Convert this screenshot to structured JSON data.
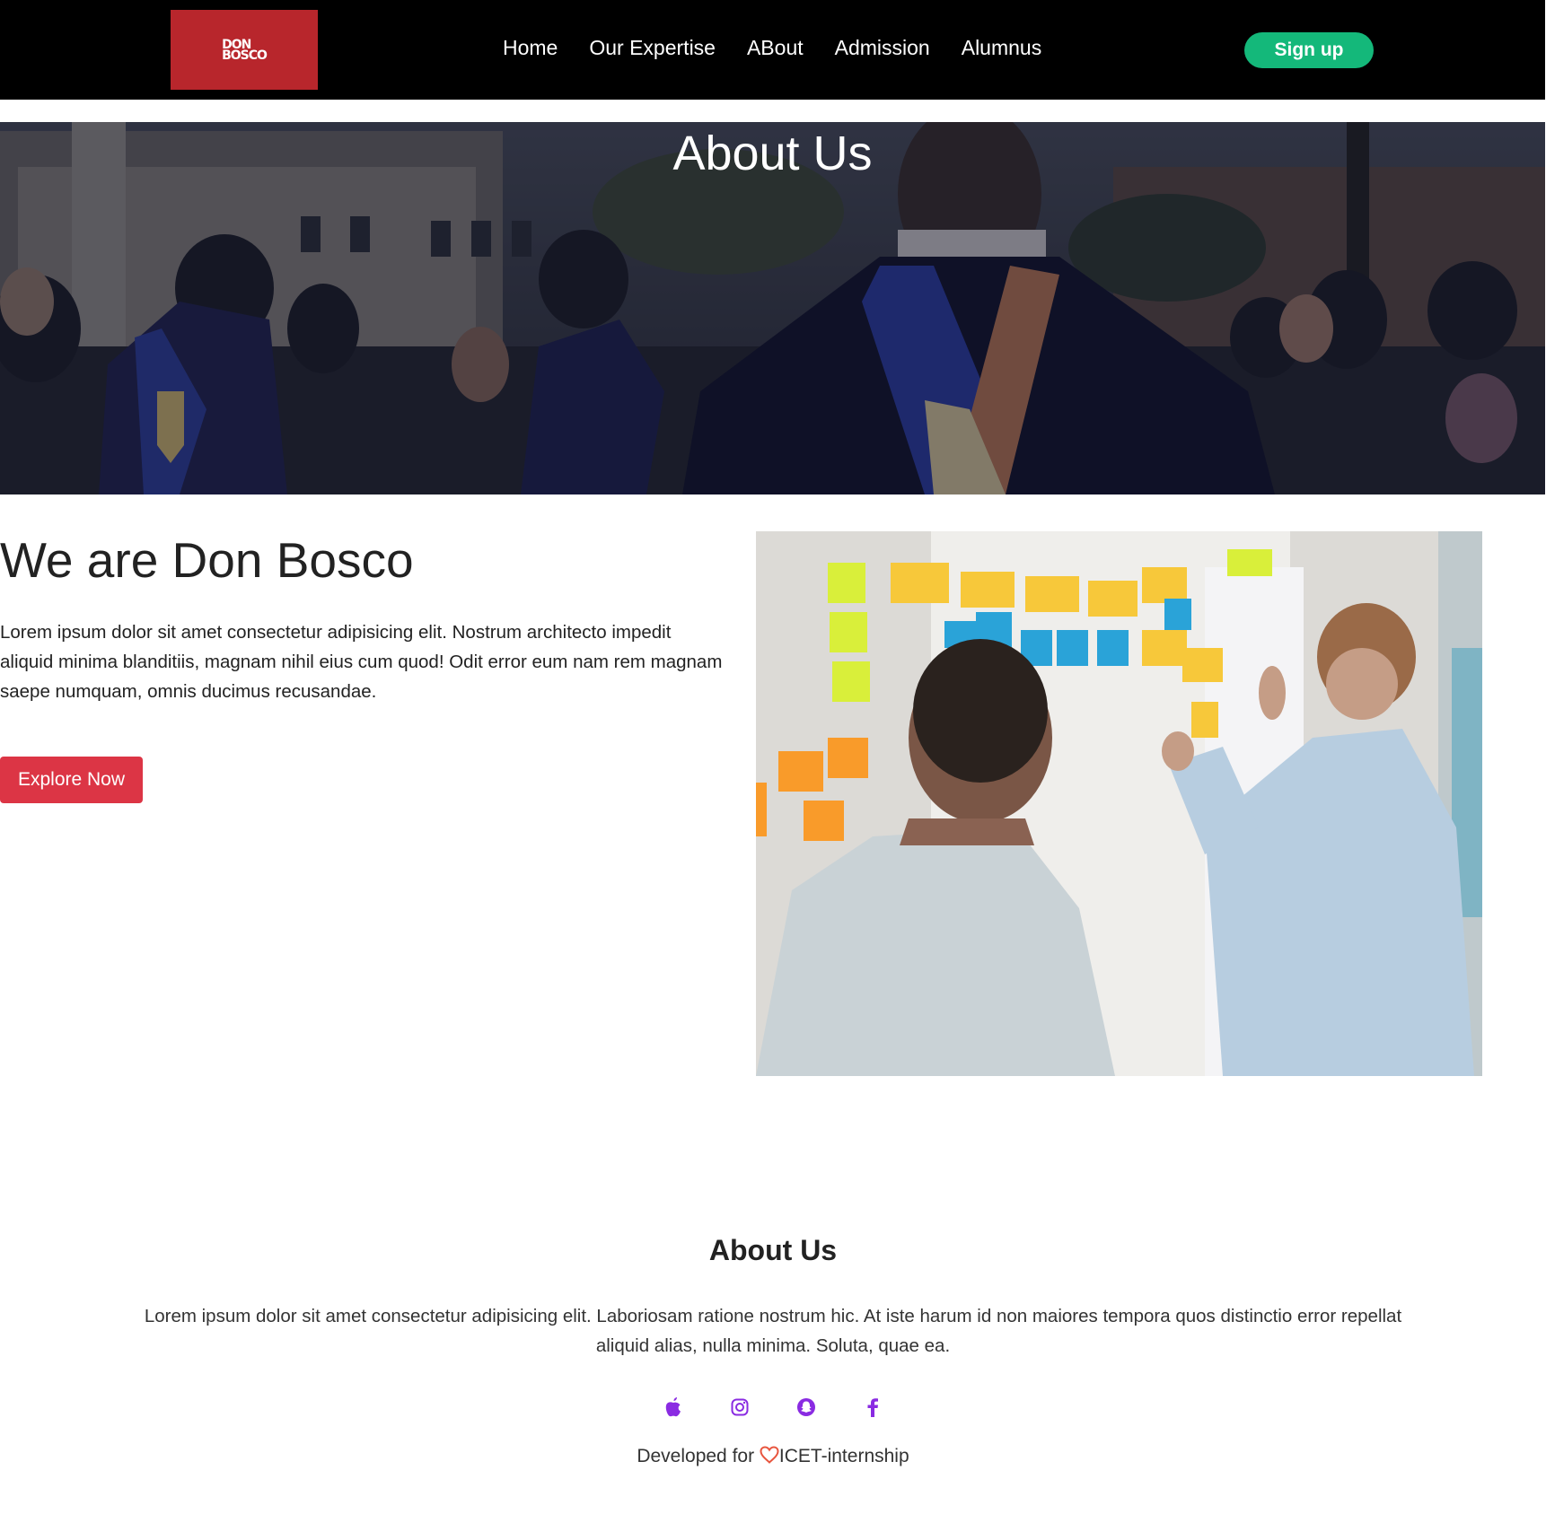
{
  "brand": {
    "logo_text_line1": "DON",
    "logo_text_line2": "BOSCO",
    "logo_color": "#b8262c"
  },
  "nav": {
    "items": [
      {
        "label": "Home"
      },
      {
        "label": "Our Expertise"
      },
      {
        "label": "ABout"
      },
      {
        "label": "Admission"
      },
      {
        "label": "Alumnus"
      }
    ],
    "signup_label": "Sign up",
    "signup_color": "#14b87a"
  },
  "hero": {
    "title": "About Us",
    "image": "graduation-crowd-photo"
  },
  "intro": {
    "heading": "We are Don Bosco",
    "paragraph": "Lorem ipsum dolor sit amet consectetur adipisicing elit. Nostrum architecto impedit aliquid minima blanditiis, magnam nihil eius cum quod! Odit error eum nam rem magnam saepe numquam, omnis ducimus recusandae.",
    "button_label": "Explore Now",
    "button_color": "#dc3545",
    "image": "sticky-notes-whiteboard-photo"
  },
  "footer": {
    "title": "About Us",
    "text": "Lorem ipsum dolor sit amet consectetur adipisicing elit. Laboriosam ratione nostrum hic. At iste harum id non maiores tempora quos distinctio error repellat aliquid alias, nulla minima. Soluta, quae ea.",
    "socials": [
      "apple-icon",
      "instagram-icon",
      "snapchat-icon",
      "facebook-icon"
    ],
    "social_color": "#8a2be2",
    "credit_prefix": "Developed for ",
    "credit_suffix": "ICET-internship",
    "heart_color": "#e8553e"
  }
}
